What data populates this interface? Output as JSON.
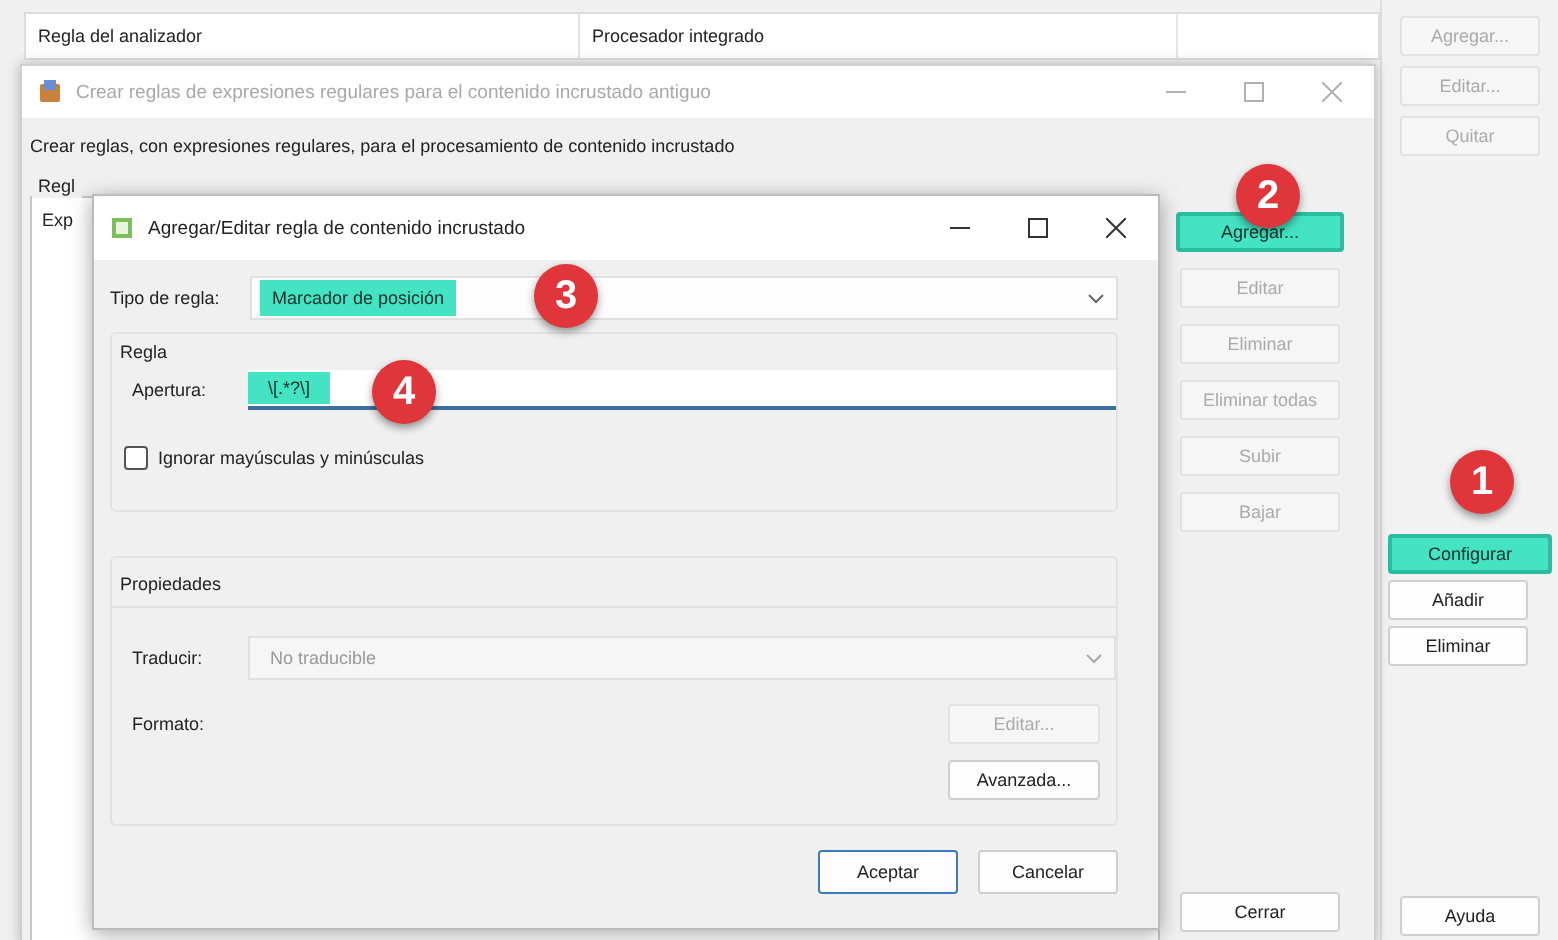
{
  "parser_window": {
    "columns": [
      "Regla del analizador",
      "Procesador integrado"
    ],
    "buttons": [
      {
        "label": "Agregar...",
        "disabled": true,
        "highlighted": false
      },
      {
        "label": "Editar...",
        "disabled": true,
        "highlighted": false
      },
      {
        "label": "Quitar",
        "disabled": true,
        "highlighted": false
      },
      {
        "label": "Configurar",
        "disabled": false,
        "highlighted": true
      },
      {
        "label": "Añadir",
        "disabled": false,
        "highlighted": false
      },
      {
        "label": "Eliminar",
        "disabled": false,
        "highlighted": false
      }
    ],
    "help_button": "Ayuda"
  },
  "regex_window": {
    "title": "Crear reglas de expresiones regulares para el contenido incrustado antiguo",
    "active": false,
    "description": "Crear reglas, con expresiones regulares, para el procesamiento de contenido incrustado",
    "tab": "Regl",
    "row": "Exp",
    "buttons": [
      {
        "label": "Agregar...",
        "disabled": false,
        "highlighted": true
      },
      {
        "label": "Editar",
        "disabled": true,
        "highlighted": false
      },
      {
        "label": "Eliminar",
        "disabled": true,
        "highlighted": false
      },
      {
        "label": "Eliminar todas",
        "disabled": true,
        "highlighted": false
      },
      {
        "label": "Subir",
        "disabled": true,
        "highlighted": false
      },
      {
        "label": "Bajar",
        "disabled": true,
        "highlighted": false
      }
    ],
    "close_button": "Cerrar"
  },
  "rule_dialog": {
    "title": "Agregar/Editar regla de contenido incrustado",
    "active": true,
    "rule_type": {
      "label": "Tipo de regla:",
      "value": "Marcador de posición",
      "highlighted": true
    },
    "rule_group": "Regla",
    "opening": {
      "label": "Apertura:",
      "value": "\\[.*?\\]",
      "highlighted": true
    },
    "ignore_case": {
      "label": "Ignorar mayúsculas y minúsculas",
      "checked": false
    },
    "properties_group": "Propiedades",
    "translate": {
      "label": "Traducir:",
      "value": "No traducible",
      "disabled": true
    },
    "format": {
      "label": "Formato:"
    },
    "edit_button": {
      "label": "Editar...",
      "disabled": true
    },
    "advanced_button": {
      "label": "Avanzada...",
      "disabled": false
    },
    "buttons": [
      {
        "label": "Aceptar",
        "default": true
      },
      {
        "label": "Cancelar",
        "default": false
      }
    ]
  },
  "callouts": [
    {
      "number": "1"
    },
    {
      "number": "2"
    },
    {
      "number": "3"
    },
    {
      "number": "4"
    }
  ]
}
